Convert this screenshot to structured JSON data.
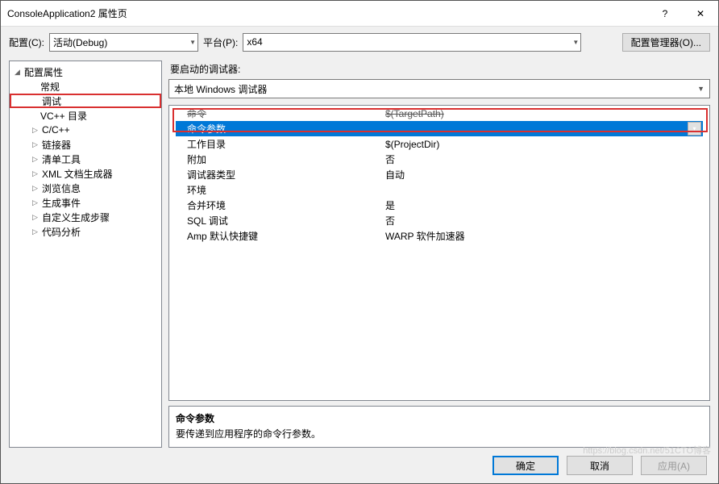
{
  "window": {
    "title": "ConsoleApplication2 属性页",
    "help": "?",
    "close": "✕"
  },
  "toolbar": {
    "config_label": "配置(C):",
    "config_value": "活动(Debug)",
    "platform_label": "平台(P):",
    "platform_value": "x64",
    "config_mgr": "配置管理器(O)..."
  },
  "tree": {
    "root": "配置属性",
    "items": [
      {
        "label": "常规",
        "kind": "leaf"
      },
      {
        "label": "调试",
        "kind": "leaf",
        "highlighted": true
      },
      {
        "label": "VC++ 目录",
        "kind": "leaf"
      },
      {
        "label": "C/C++",
        "kind": "branch"
      },
      {
        "label": "链接器",
        "kind": "branch"
      },
      {
        "label": "清单工具",
        "kind": "branch"
      },
      {
        "label": "XML 文档生成器",
        "kind": "branch"
      },
      {
        "label": "浏览信息",
        "kind": "branch"
      },
      {
        "label": "生成事件",
        "kind": "branch"
      },
      {
        "label": "自定义生成步骤",
        "kind": "branch"
      },
      {
        "label": "代码分析",
        "kind": "branch"
      }
    ]
  },
  "debugger": {
    "launch_label": "要启动的调试器:",
    "launch_value": "本地 Windows 调试器"
  },
  "grid": [
    {
      "name": "命令",
      "value": "$(TargetPath)",
      "strike": true
    },
    {
      "name": "命令参数",
      "value": "",
      "selected": true
    },
    {
      "name": "工作目录",
      "value": "$(ProjectDir)"
    },
    {
      "name": "附加",
      "value": "否"
    },
    {
      "name": "调试器类型",
      "value": "自动"
    },
    {
      "name": "环境",
      "value": ""
    },
    {
      "name": "合并环境",
      "value": "是"
    },
    {
      "name": "SQL 调试",
      "value": "否"
    },
    {
      "name": "Amp 默认快捷键",
      "value": "WARP 软件加速器"
    }
  ],
  "description": {
    "title": "命令参数",
    "text": "要传递到应用程序的命令行参数。"
  },
  "footer": {
    "ok": "确定",
    "cancel": "取消",
    "apply": "应用(A)"
  },
  "watermark": "https://blog.csdn.net/51CTO博客"
}
